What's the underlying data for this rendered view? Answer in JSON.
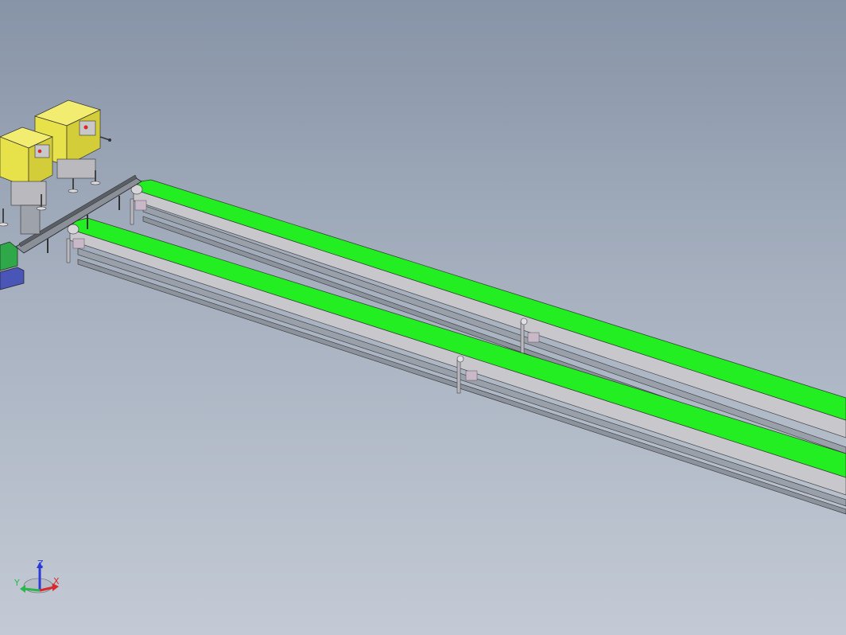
{
  "viewport": {
    "background_top": "#8794a7",
    "background_bottom": "#c3cad5"
  },
  "model": {
    "belt_color": "#22ee22",
    "frame_color": "#c8c8cc",
    "machine_color": "#e8e24a",
    "green_box_color": "#2fa84a",
    "blue_box_color": "#4a55b8"
  },
  "triad": {
    "z_label": "Z",
    "y_label": "Y",
    "x_label": "X",
    "z_color": "#2a3ad8",
    "y_color": "#2ab84a",
    "x_color": "#d82a2a"
  }
}
